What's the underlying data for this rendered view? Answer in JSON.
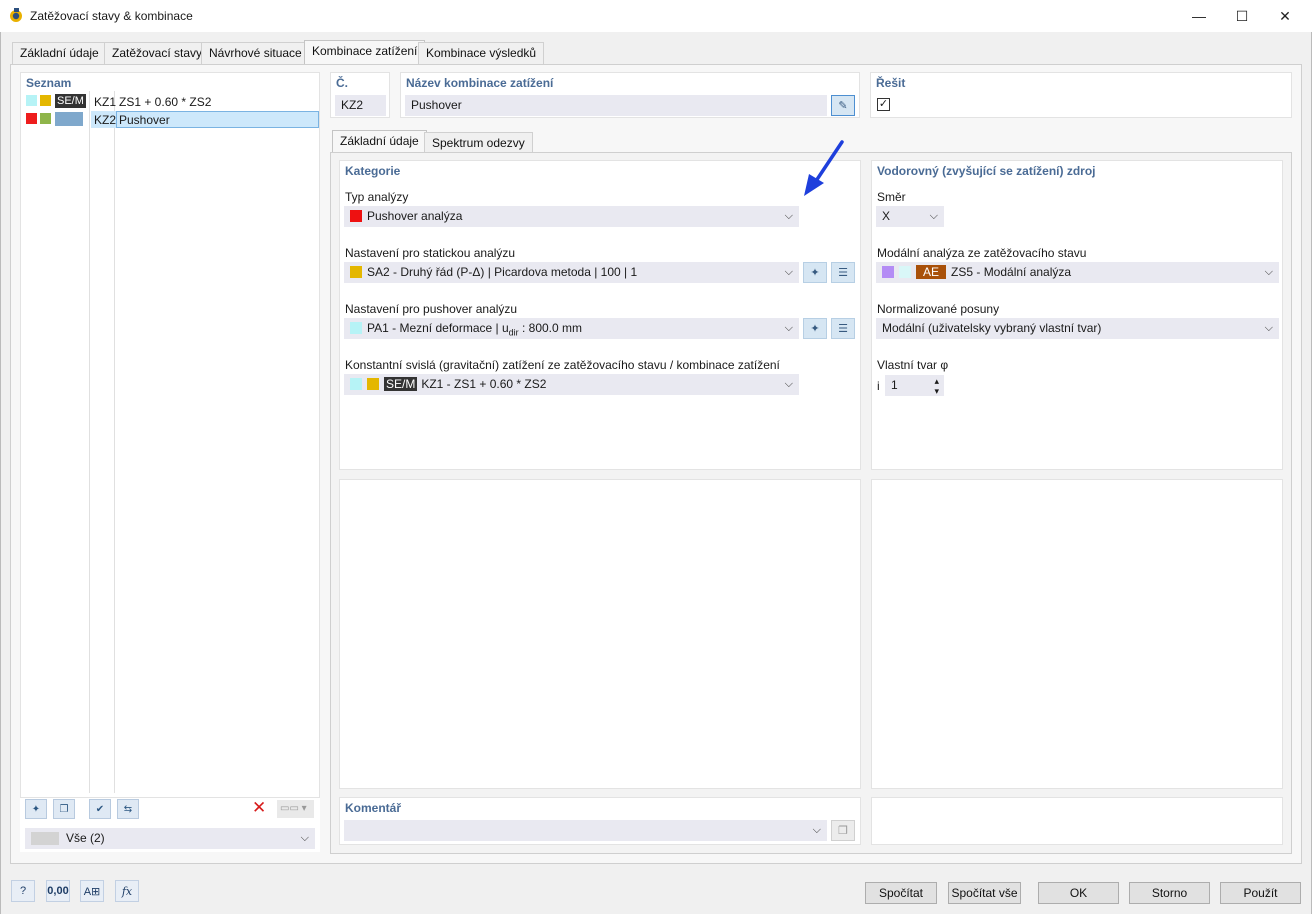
{
  "window": {
    "title": "Zatěžovací stavy & kombinace",
    "minimize_glyph": "—",
    "maximize_glyph": "☐",
    "close_glyph": "✕"
  },
  "main_tabs": [
    {
      "label": "Základní údaje"
    },
    {
      "label": "Zatěžovací stavy"
    },
    {
      "label": "Návrhové situace"
    },
    {
      "label": "Kombinace zatížení"
    },
    {
      "label": "Kombinace výsledků"
    }
  ],
  "list": {
    "header": "Seznam",
    "items": [
      {
        "badge": "SE/M",
        "id": "KZ1",
        "name": "ZS1 + 0.60 * ZS2",
        "colors": [
          "#b6f3f6",
          "#e4b700"
        ]
      },
      {
        "badge": "",
        "id": "KZ2",
        "name": "Pushover",
        "colors": [
          "#ee1d1d",
          "#8fb54a",
          "#7fa8cc"
        ]
      }
    ],
    "filter_value": "Vše (2)",
    "filter_arrow": "⌵",
    "delete_glyph": "✕"
  },
  "header_fields": {
    "number_label": "Č.",
    "number_value": "KZ2",
    "name_label": "Název kombinace zatížení",
    "name_value": "Pushover",
    "solve_label": "Řešit",
    "solve_checked": "✓"
  },
  "sub_tabs": [
    {
      "label": "Základní údaje"
    },
    {
      "label": "Spektrum odezvy"
    }
  ],
  "category": {
    "header": "Kategorie",
    "analysis_type_label": "Typ analýzy",
    "analysis_type_value": "Pushover analýza",
    "analysis_type_color": "#ee1111",
    "static_label": "Nastavení pro statickou analýzu",
    "static_value": "SA2 - Druhý řád (P-Δ) | Picardova metoda | 100 | 1",
    "static_color": "#e4b700",
    "pushover_label": "Nastavení pro pushover analýzu",
    "pushover_value_prefix": "PA1 - Mezní deformace | u",
    "pushover_value_sub": "dir",
    "pushover_value_suffix": " : 800.0 mm",
    "pushover_color": "#b6f3f6",
    "constant_label": "Konstantní svislá (gravitační) zatížení ze zatěžovacího stavu / kombinace zatížení",
    "constant_badge": "SE/M",
    "constant_value": "KZ1 - ZS1 + 0.60 * ZS2"
  },
  "horizontal": {
    "header": "Vodorovný (zvyšující se zatížení) zdroj",
    "direction_label": "Směr",
    "direction_value": "X",
    "modal_label": "Modální analýza ze zatěžovacího stavu",
    "modal_badge": "AE",
    "modal_value": "ZS5 - Modální analýza",
    "modal_color": "#b48cf5",
    "norm_label": "Normalizované posuny",
    "norm_value": "Modální (uživatelsky vybraný vlastní tvar)",
    "mode_label": "Vlastní tvar φ",
    "mode_index_label": "i",
    "mode_value": "1",
    "spin_up": "▴",
    "spin_down": "▾"
  },
  "comment": {
    "header": "Komentář",
    "value": ""
  },
  "buttons": {
    "calculate": "Spočítat",
    "calculate_all": "Spočítat vše",
    "ok": "OK",
    "cancel": "Storno",
    "apply": "Použít"
  },
  "icons": [
    "help-icon",
    "units-icon",
    "display-icon",
    "formula-icon",
    "new-icon",
    "edit-icon",
    "check-icon",
    "refresh-icon"
  ],
  "accent_arrow_color": "#1e3fdc"
}
